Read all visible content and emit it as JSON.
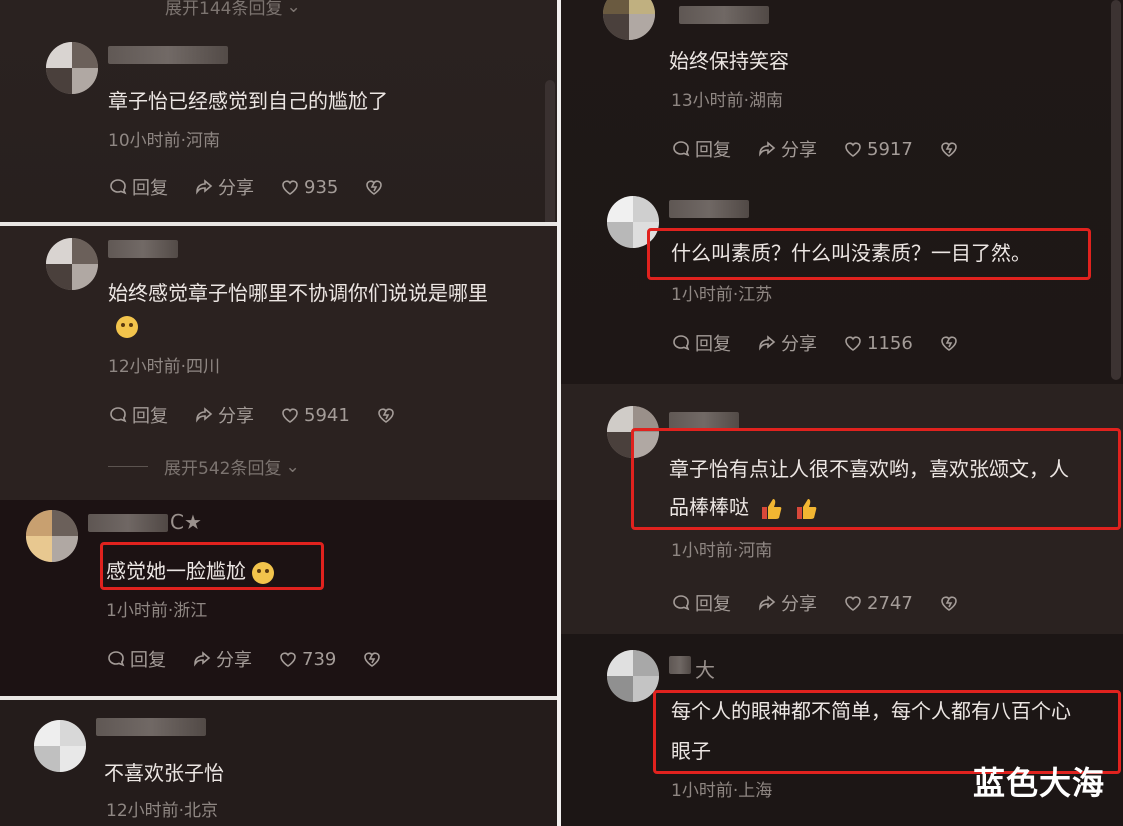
{
  "left": {
    "top_expand": "展开144条回复",
    "comments": [
      {
        "text": "章子怡已经感觉到自己的尴尬了",
        "meta": "10小时前·河南",
        "reply": "回复",
        "share": "分享",
        "likes": "935"
      },
      {
        "text_line1": "始终感觉章子怡哪里不协调你们说说是哪里",
        "meta": "12小时前·四川",
        "reply": "回复",
        "share": "分享",
        "likes": "5941",
        "expand": "展开542条回复"
      },
      {
        "name_suffix": "C★",
        "text": "感觉她一脸尴尬",
        "meta": "1小时前·浙江",
        "reply": "回复",
        "share": "分享",
        "likes": "739"
      },
      {
        "text": "不喜欢张子怡",
        "meta": "12小时前·北京"
      }
    ]
  },
  "right": {
    "comments": [
      {
        "text": "始终保持笑容",
        "meta": "13小时前·湖南",
        "reply": "回复",
        "share": "分享",
        "likes": "5917"
      },
      {
        "text": "什么叫素质？什么叫没素质？一目了然。",
        "meta": "1小时前·江苏",
        "reply": "回复",
        "share": "分享",
        "likes": "1156"
      },
      {
        "text_line1": "章子怡有点让人很不喜欢哟，喜欢张颂文，人",
        "text_line2": "品棒棒哒",
        "meta": "1小时前·河南",
        "reply": "回复",
        "share": "分享",
        "likes": "2747"
      },
      {
        "name_suffix": "大",
        "text_line1": "每个人的眼神都不简单，每个人都有八百个心",
        "text_line2": "眼子",
        "meta": "1小时前·上海"
      }
    ]
  },
  "watermark": "蓝色大海",
  "colors": {
    "highlight": "#e0221e",
    "text": "#ece6e3",
    "meta": "#8f8783"
  },
  "icons": [
    "comment-icon",
    "share-icon",
    "heart-icon",
    "dislike-heart-icon",
    "emoji-icon",
    "thumbs-up-icon"
  ]
}
